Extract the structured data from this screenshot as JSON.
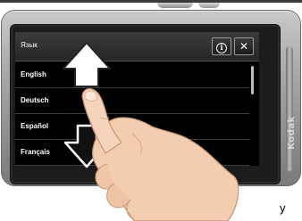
{
  "screen": {
    "header_title": "Язык",
    "info_label": "i",
    "close_label": "✕"
  },
  "languages": [
    "English",
    "Deutsch",
    "Español",
    "Français"
  ],
  "device": {
    "brand": "Kodak"
  },
  "caption": "y",
  "gesture": {
    "up_arrow_icon": "arrow-up-icon",
    "down_arrow_icon": "arrow-down-icon",
    "hand_icon": "pointing-hand-icon"
  }
}
